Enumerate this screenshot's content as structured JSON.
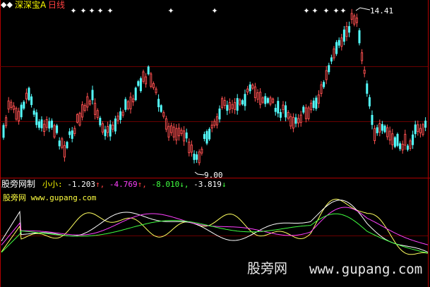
{
  "header": {
    "title": "深深宝A",
    "period": "日线",
    "marker": "◆"
  },
  "price_panel": {
    "high_label": "14.41",
    "low_label": "9.00",
    "star_glyph": "✦"
  },
  "indicator_panel": {
    "name": "股旁网制",
    "prefix": "小小:",
    "values": [
      {
        "value": "-1.203",
        "arrow": "↑",
        "color": "#ffffff"
      },
      {
        "value": "-4.769",
        "arrow": "↑",
        "color": "#ff40ff"
      },
      {
        "value": "-8.010",
        "arrow": "↓",
        "color": "#40ff40"
      },
      {
        "value": "-3.819",
        "arrow": "↓",
        "color": "#ffffff"
      }
    ],
    "arrow_colors": {
      "up": "#ff4040",
      "down": "#40ff40"
    }
  },
  "watermarks": {
    "inner": "股旁网 www.gupang.com",
    "big_cn": "股旁网",
    "big_url": "www.gupang.com"
  },
  "colors": {
    "background": "#000000",
    "frame": "#b00000",
    "grid": "#6a0000",
    "up_candle": "#ff5050",
    "down_candle": "#54ffff",
    "ma_white": "#ffffff",
    "ma_yellow": "#ffff60",
    "ma_magenta": "#ff40ff",
    "ma_green": "#40ff40",
    "title_yellow": "#ffff00"
  }
}
